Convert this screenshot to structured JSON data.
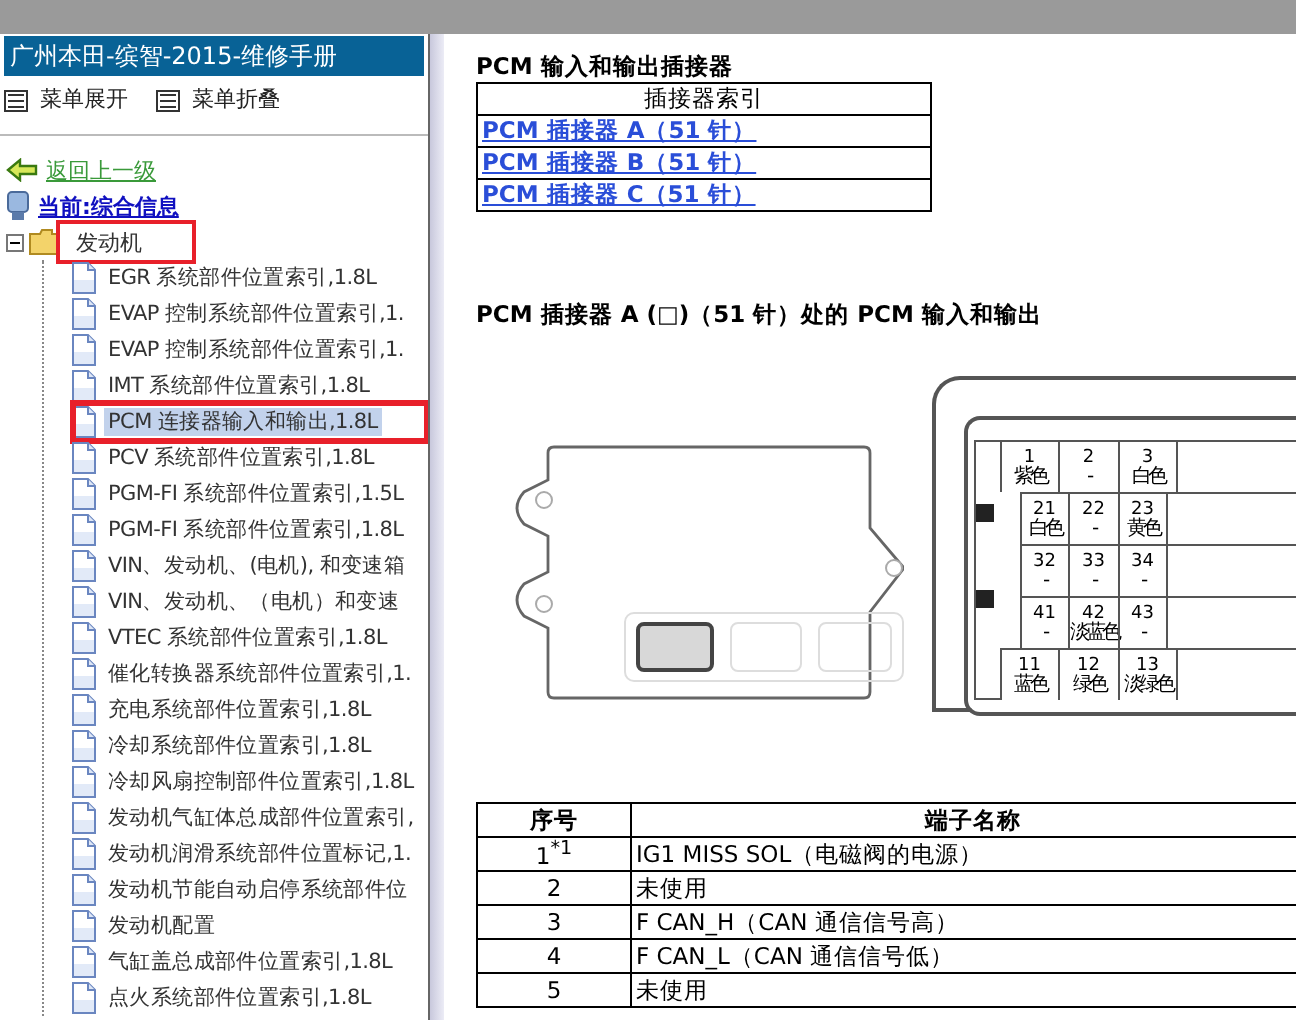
{
  "window": {
    "title": "广州本田-缤智-2015-维修手册"
  },
  "menu_buttons": [
    {
      "label": "菜单展开"
    },
    {
      "label": "菜单折叠"
    }
  ],
  "back_link": "返回上一级",
  "current": "当前:综合信息",
  "tree": [
    {
      "label": "发动机",
      "expanded": true,
      "annotated": true,
      "children": [
        {
          "label": "EGR 系统部件位置索引,1.8L",
          "selected": false,
          "annotated": false
        },
        {
          "label": "EVAP 控制系统部件位置索引,1.",
          "selected": false,
          "annotated": false
        },
        {
          "label": "EVAP 控制系统部件位置索引,1.",
          "selected": false,
          "annotated": false
        },
        {
          "label": "IMT 系统部件位置索引,1.8L",
          "selected": false,
          "annotated": false
        },
        {
          "label": "PCM 连接器输入和输出,1.8L",
          "selected": true,
          "annotated": true
        },
        {
          "label": "PCV 系统部件位置索引,1.8L",
          "selected": false,
          "annotated": false
        },
        {
          "label": "PGM-FI 系统部件位置索引,1.5L",
          "selected": false,
          "annotated": false
        },
        {
          "label": "PGM-FI 系统部件位置索引,1.8L",
          "selected": false,
          "annotated": false
        },
        {
          "label": "VIN、发动机、(电机), 和变速箱",
          "selected": false,
          "annotated": false
        },
        {
          "label": "VIN、发动机、（电机）和变速",
          "selected": false,
          "annotated": false
        },
        {
          "label": "VTEC 系统部件位置索引,1.8L",
          "selected": false,
          "annotated": false
        },
        {
          "label": "催化转换器系统部件位置索引,1.",
          "selected": false,
          "annotated": false
        },
        {
          "label": "充电系统部件位置索引,1.8L",
          "selected": false,
          "annotated": false
        },
        {
          "label": "冷却系统部件位置索引,1.8L",
          "selected": false,
          "annotated": false
        },
        {
          "label": "冷却风扇控制部件位置索引,1.8L",
          "selected": false,
          "annotated": false
        },
        {
          "label": "发动机气缸体总成部件位置索引,",
          "selected": false,
          "annotated": false
        },
        {
          "label": "发动机润滑系统部件位置标记,1.",
          "selected": false,
          "annotated": false
        },
        {
          "label": "发动机节能自动启停系统部件位",
          "selected": false,
          "annotated": false
        },
        {
          "label": "发动机配置",
          "selected": false,
          "annotated": false
        },
        {
          "label": "气缸盖总成部件位置索引,1.8L",
          "selected": false,
          "annotated": false
        },
        {
          "label": "点火系统部件位置索引,1.8L",
          "selected": false,
          "annotated": false
        }
      ]
    }
  ],
  "section_title": "PCM 输入和输出插接器",
  "index_table": {
    "header": "插接器索引",
    "links": [
      "PCM 插接器 A（51 针）",
      "PCM 插接器 B（51 针）",
      "PCM 插接器 C（51 针）"
    ]
  },
  "connector_title": "PCM 插接器 A (□)（51 针）处的 PCM 输入和输出",
  "ecu_sockets": [
    {
      "selected": true
    },
    {
      "selected": false
    },
    {
      "selected": false
    }
  ],
  "connector_rows": [
    {
      "kind": "wide",
      "cells": [
        {
          "num": "1",
          "wire": "紫色"
        },
        {
          "num": "2",
          "wire": "-"
        },
        {
          "num": "3",
          "wire": "白色"
        }
      ]
    },
    {
      "kind": "narrow",
      "cells": [
        {
          "num": "21",
          "wire": "白色"
        },
        {
          "num": "22",
          "wire": "-"
        },
        {
          "num": "23",
          "wire": "黄色"
        }
      ]
    },
    {
      "kind": "narrow",
      "cells": [
        {
          "num": "32",
          "wire": "-"
        },
        {
          "num": "33",
          "wire": "-"
        },
        {
          "num": "34",
          "wire": "-"
        }
      ]
    },
    {
      "kind": "narrow",
      "cells": [
        {
          "num": "41",
          "wire": "-"
        },
        {
          "num": "42",
          "wire": "淡蓝色"
        },
        {
          "num": "43",
          "wire": "-"
        }
      ]
    },
    {
      "kind": "wide",
      "cells": [
        {
          "num": "11",
          "wire": "蓝色"
        },
        {
          "num": "12",
          "wire": "绿色"
        },
        {
          "num": "13",
          "wire": "淡绿色"
        }
      ]
    }
  ],
  "terminal_table": {
    "columns": [
      "序号",
      "端子名称"
    ],
    "rows": [
      [
        "1$^{*1}$",
        "IG1 MISS SOL（电磁阀的电源）"
      ],
      [
        "2",
        "未使用"
      ],
      [
        "3",
        "F CAN_H（CAN 通信信号高）"
      ],
      [
        "4",
        "F CAN_L（CAN 通信信号低）"
      ],
      [
        "5",
        "未使用"
      ]
    ]
  }
}
